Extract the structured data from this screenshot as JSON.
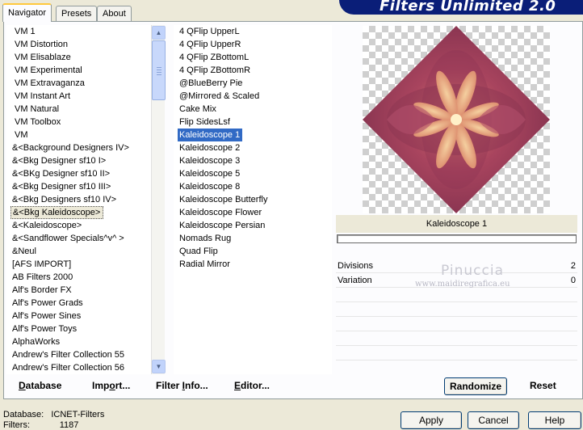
{
  "tabs": [
    "Navigator",
    "Presets",
    "About"
  ],
  "banner_title": "Filters Unlimited 2.0",
  "categories": [
    "VM 1",
    "VM Distortion",
    "VM Elisablaze",
    "VM Experimental",
    "VM Extravaganza",
    "VM Instant Art",
    "VM Natural",
    "VM Toolbox",
    "VM",
    "&<Background Designers IV>",
    "&<Bkg Designer sf10 I>",
    "&<BKg Designer sf10 II>",
    "&<Bkg Designer sf10 III>",
    "&<Bkg Designers sf10 IV>",
    "&<Bkg Kaleidoscope>",
    "&<Kaleidoscope>",
    "&<Sandflower Specials^v^ >",
    "&Neul",
    "[AFS IMPORT]",
    "AB Filters 2000",
    "Alf's Border FX",
    "Alf's Power Grads",
    "Alf's Power Sines",
    "Alf's Power Toys",
    "AlphaWorks",
    "Andrew's Filter Collection 55",
    "Andrew's Filter Collection 56"
  ],
  "selected_category": "&<Bkg Kaleidoscope>",
  "filters": [
    "4 QFlip UpperL",
    "4 QFlip UpperR",
    "4 QFlip ZBottomL",
    "4 QFlip ZBottomR",
    "@BlueBerry Pie",
    "@Mirrored & Scaled",
    "Cake Mix",
    "Flip SidesLsf",
    "Kaleidoscope 1",
    "Kaleidoscope 2",
    "Kaleidoscope 3",
    "Kaleidoscope 5",
    "Kaleidoscope 8",
    "Kaleidoscope Butterfly",
    "Kaleidoscope Flower",
    "Kaleidoscope Persian",
    "Nomads Rug",
    "Quad Flip",
    "Radial Mirror"
  ],
  "selected_filter": "Kaleidoscope 1",
  "bottom_links": {
    "database": {
      "u": "D",
      "rest": "atabase"
    },
    "import": {
      "pre": "Imp",
      "u": "o",
      "rest": "rt..."
    },
    "filter_info": {
      "pre": "Filter ",
      "u": "I",
      "rest": "nfo..."
    },
    "editor": {
      "u": "E",
      "rest": "ditor..."
    }
  },
  "preview": {
    "caption": "Kaleidoscope 1",
    "progress": 0,
    "params": [
      {
        "label": "Divisions",
        "value": "2"
      },
      {
        "label": "Variation",
        "value": "0"
      }
    ],
    "watermark_line1": "Pinuccia",
    "watermark_line2": "www.maidiregrafica.eu"
  },
  "buttons": {
    "randomize": "Randomize",
    "reset": "Reset",
    "apply": "Apply",
    "cancel": "Cancel",
    "help": "Help"
  },
  "status": {
    "database_label": "Database:",
    "database_value": "ICNET-Filters",
    "filters_label": "Filters:",
    "filters_value": "1187"
  },
  "colors": {
    "selection": "#316ac5",
    "banner": "#0a1e78",
    "kaleidoscope_base": "#9a3f5e"
  }
}
